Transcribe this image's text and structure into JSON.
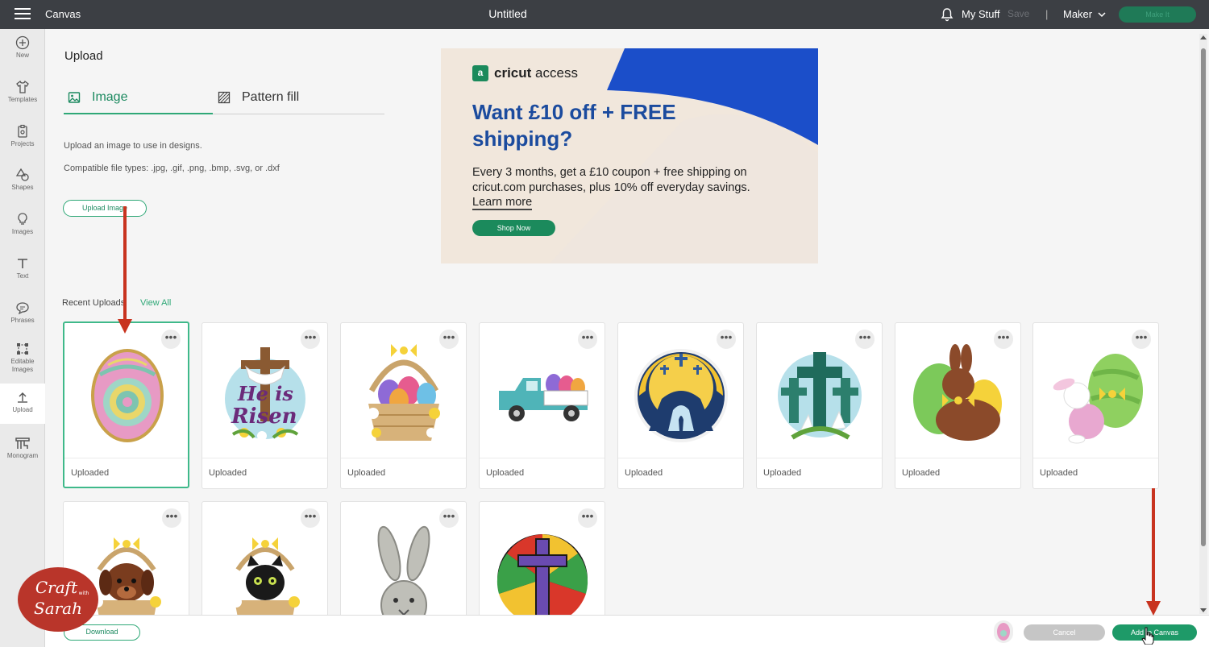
{
  "topbar": {
    "app_title": "Canvas",
    "doc_title": "Untitled",
    "my_stuff": "My Stuff",
    "save": "Save",
    "separator": "|",
    "machine": "Maker",
    "make_it": "Make It"
  },
  "sidebar": {
    "items": [
      {
        "label": "New",
        "icon": "plus-circle-icon"
      },
      {
        "label": "Templates",
        "icon": "shirt-icon"
      },
      {
        "label": "Projects",
        "icon": "clipboard-icon"
      },
      {
        "label": "Shapes",
        "icon": "shapes-icon"
      },
      {
        "label": "Images",
        "icon": "lightbulb-icon"
      },
      {
        "label": "Text",
        "icon": "text-icon"
      },
      {
        "label": "Phrases",
        "icon": "speech-bubble-icon"
      },
      {
        "label": "Editable Images",
        "icon": "editable-image-icon"
      },
      {
        "label": "Upload",
        "icon": "upload-icon"
      },
      {
        "label": "Monogram",
        "icon": "monogram-icon"
      }
    ]
  },
  "upload": {
    "heading": "Upload",
    "tabs": [
      {
        "label": "Image",
        "icon": "image-icon"
      },
      {
        "label": "Pattern fill",
        "icon": "pattern-icon"
      }
    ],
    "description": "Upload an image to use in designs.",
    "file_types": "Compatible file types: .jpg, .gif, .png, .bmp, .svg, or .dxf",
    "upload_button": "Upload Image"
  },
  "ad": {
    "logo_box": "a",
    "logo_brand": "cricut",
    "logo_suffix": "access",
    "headline": "Want £10 off + FREE shipping?",
    "body": "Every 3 months, get a £10 coupon + free shipping on cricut.com purchases, plus 10% off everyday savings.",
    "learn_more": "Learn more",
    "shop_now": "Shop Now",
    "colors": {
      "blue": "#1b4ec9",
      "green": "#1b8a5c",
      "beige": "#f1e7dc"
    }
  },
  "recent": {
    "label": "Recent Uploads",
    "view_all": "View All",
    "more_label": "•••",
    "items": [
      {
        "caption": "Uploaded",
        "image": "easter-egg-mandala"
      },
      {
        "caption": "Uploaded",
        "image": "he-is-risen-cross"
      },
      {
        "caption": "Uploaded",
        "image": "easter-basket-eggs"
      },
      {
        "caption": "Uploaded",
        "image": "truck-with-eggs"
      },
      {
        "caption": "Uploaded",
        "image": "empty-tomb"
      },
      {
        "caption": "Uploaded",
        "image": "three-crosses-lilies"
      },
      {
        "caption": "Uploaded",
        "image": "chocolate-bunny"
      },
      {
        "caption": "Uploaded",
        "image": "bunny-with-egg"
      },
      {
        "caption": "",
        "image": "puppy-in-basket"
      },
      {
        "caption": "",
        "image": "kitten-in-basket"
      },
      {
        "caption": "",
        "image": "bunny-mandala"
      },
      {
        "caption": "",
        "image": "stained-glass-cross"
      }
    ]
  },
  "bottombar": {
    "download": "Download",
    "cancel": "Cancel",
    "add_to_canvas": "Add to Canvas"
  },
  "watermark": {
    "line1": "Craft",
    "line2": "with",
    "line3": "Sarah"
  }
}
